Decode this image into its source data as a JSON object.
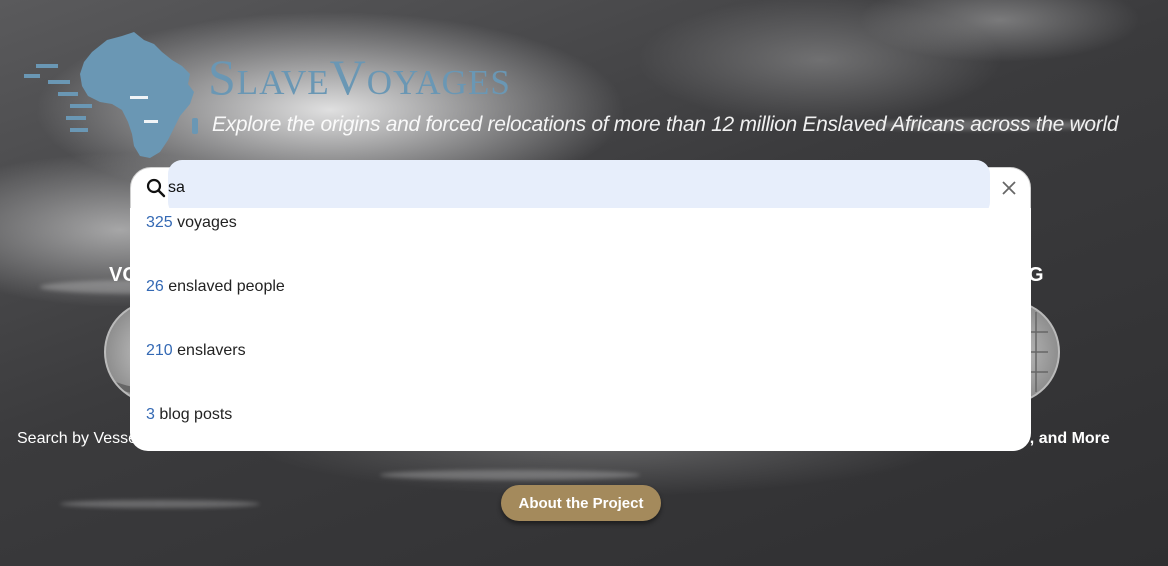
{
  "header": {
    "brand_title": "SlaveVoyages",
    "tagline": "Explore the origins and forced relocations of more than 12 million Enslaved Africans across the world"
  },
  "search": {
    "query": "sa",
    "placeholder": ""
  },
  "results": [
    {
      "count": "325",
      "label": "voyages"
    },
    {
      "count": "26",
      "label": "enslaved people"
    },
    {
      "count": "210",
      "label": "enslavers"
    },
    {
      "count": "3",
      "label": "blog posts"
    }
  ],
  "left_panel": {
    "heading": "VO",
    "caption": "Search by Vesse"
  },
  "right_panel": {
    "heading": "G",
    "caption": "ys, and More"
  },
  "about_button": "About the Project",
  "colors": {
    "brand": "#6a97b4",
    "result_count": "#3469b4",
    "about_button": "#a48a5c",
    "search_highlight": "#e7eefb"
  }
}
